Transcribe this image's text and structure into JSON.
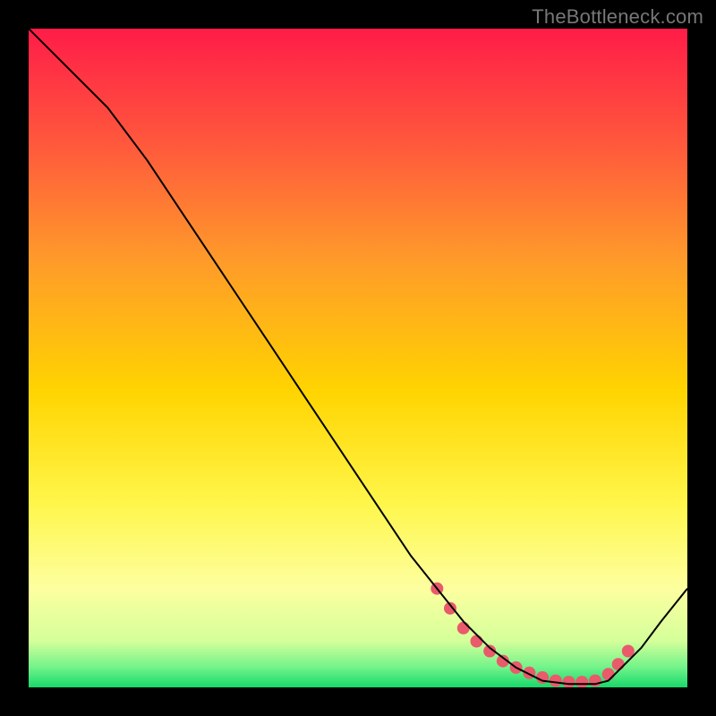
{
  "watermark": "TheBottleneck.com",
  "chart_data": {
    "type": "line",
    "title": "",
    "xlabel": "",
    "ylabel": "",
    "xlim": [
      0,
      100
    ],
    "ylim": [
      0,
      100
    ],
    "grid": false,
    "legend": false,
    "background_gradient": {
      "stops": [
        {
          "offset": 0.0,
          "color": "#ff1c48"
        },
        {
          "offset": 0.18,
          "color": "#ff5a3c"
        },
        {
          "offset": 0.35,
          "color": "#ff9a2a"
        },
        {
          "offset": 0.55,
          "color": "#ffd400"
        },
        {
          "offset": 0.72,
          "color": "#fff64a"
        },
        {
          "offset": 0.85,
          "color": "#fdffa0"
        },
        {
          "offset": 0.93,
          "color": "#d4ff9a"
        },
        {
          "offset": 0.97,
          "color": "#71f38a"
        },
        {
          "offset": 1.0,
          "color": "#18d86a"
        }
      ]
    },
    "series": [
      {
        "name": "curve",
        "color": "#000000",
        "width": 2,
        "x": [
          0,
          6,
          12,
          18,
          24,
          30,
          36,
          42,
          48,
          54,
          58,
          62,
          66,
          70,
          74,
          78,
          82,
          86,
          88,
          90,
          93,
          96,
          100
        ],
        "y": [
          100,
          94,
          88,
          80,
          71,
          62,
          53,
          44,
          35,
          26,
          20,
          15,
          10,
          6,
          3,
          1,
          0.5,
          0.5,
          1,
          3,
          6,
          10,
          15
        ]
      }
    ],
    "markers": {
      "name": "highlight-dots",
      "color": "#e95a6b",
      "radius": 7,
      "x": [
        62,
        64,
        66,
        68,
        70,
        72,
        74,
        76,
        78,
        80,
        82,
        84,
        86,
        88,
        89.5,
        91
      ],
      "y": [
        15,
        12,
        9,
        7,
        5.5,
        4,
        3,
        2.2,
        1.5,
        1,
        0.8,
        0.8,
        1,
        2,
        3.5,
        5.5
      ]
    }
  }
}
